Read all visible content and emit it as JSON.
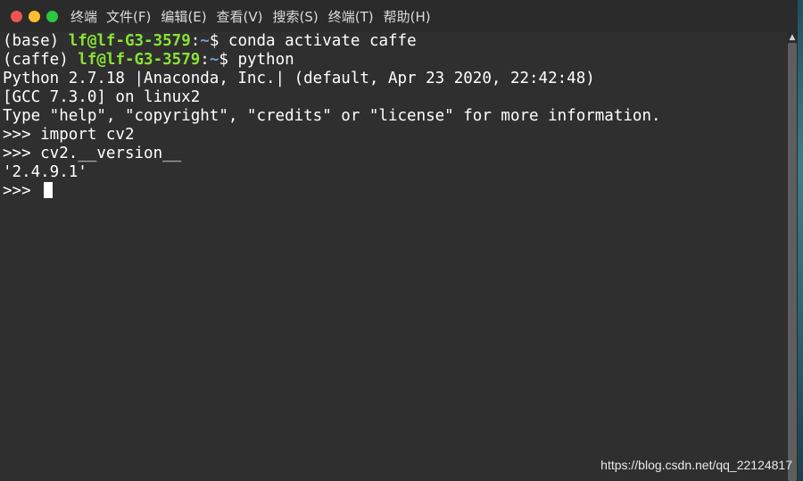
{
  "window": {
    "title": "终端",
    "buttons": {
      "close_color": "#ef5350",
      "minimize_color": "#ffbd2e",
      "maximize_color": "#28c840"
    }
  },
  "menu": [
    {
      "label": "文件(F)"
    },
    {
      "label": "编辑(E)"
    },
    {
      "label": "查看(V)"
    },
    {
      "label": "搜索(S)"
    },
    {
      "label": "终端(T)"
    },
    {
      "label": "帮助(H)"
    }
  ],
  "terminal": {
    "lines": {
      "l1": {
        "env": "(base) ",
        "user": "lf@lf-G3-3579",
        "colon": ":",
        "path": "~",
        "prompt": "$ ",
        "cmd": "conda activate caffe"
      },
      "l2": {
        "env": "(caffe) ",
        "user": "lf@lf-G3-3579",
        "colon": ":",
        "path": "~",
        "prompt": "$ ",
        "cmd": "python"
      },
      "l3": "Python 2.7.18 |Anaconda, Inc.| (default, Apr 23 2020, 22:42:48)",
      "l4": "[GCC 7.3.0] on linux2",
      "l5": "Type \"help\", \"copyright\", \"credits\" or \"license\" for more information.",
      "l6": ">>> import cv2",
      "l7": ">>> cv2.__version__",
      "l8": "'2.4.9.1'",
      "l9": ">>> "
    }
  },
  "watermark": "https://blog.csdn.net/qq_22124817",
  "colors": {
    "background": "#2f2f2f",
    "text": "#ffffff",
    "user_host": "#8ae234",
    "path": "#729fcf"
  }
}
